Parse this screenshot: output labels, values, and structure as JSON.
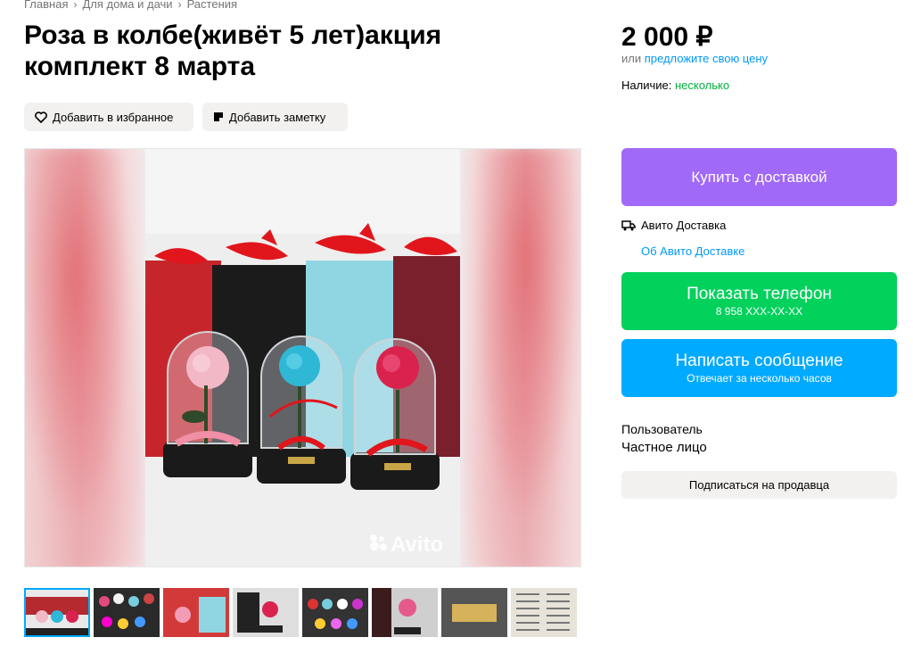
{
  "breadcrumbs": [
    "Главная",
    "Для дома и дачи",
    "Растения"
  ],
  "title": "Роза в колбе(живёт 5 лет)акция комплект 8 марта",
  "actions": {
    "favorite_label": "Добавить в избранное",
    "note_label": "Добавить заметку"
  },
  "gallery": {
    "watermark": "Avito",
    "thumbnail_count": 8,
    "active_thumbnail": 1
  },
  "price": {
    "amount": "2 000 ₽",
    "offer_prefix": "или",
    "offer_link": "предложите свою цену"
  },
  "availability": {
    "label": "Наличие:",
    "value": "несколько"
  },
  "buy_button": "Купить с доставкой",
  "delivery": {
    "label": "Авито Доставка",
    "link": "Об Авито Доставке"
  },
  "phone_button": {
    "label": "Показать телефон",
    "number": "8 958 XXX-XX-XX"
  },
  "message_button": {
    "label": "Написать сообщение",
    "sub": "Отвечает за несколько часов"
  },
  "seller": {
    "name": "Пользователь",
    "type": "Частное лицо",
    "subscribe_label": "Подписаться на продавца"
  },
  "colors": {
    "buy": "#a169f7",
    "phone": "#02d15c",
    "message": "#00aaff",
    "link": "#0099f7",
    "available": "#02b13e"
  }
}
